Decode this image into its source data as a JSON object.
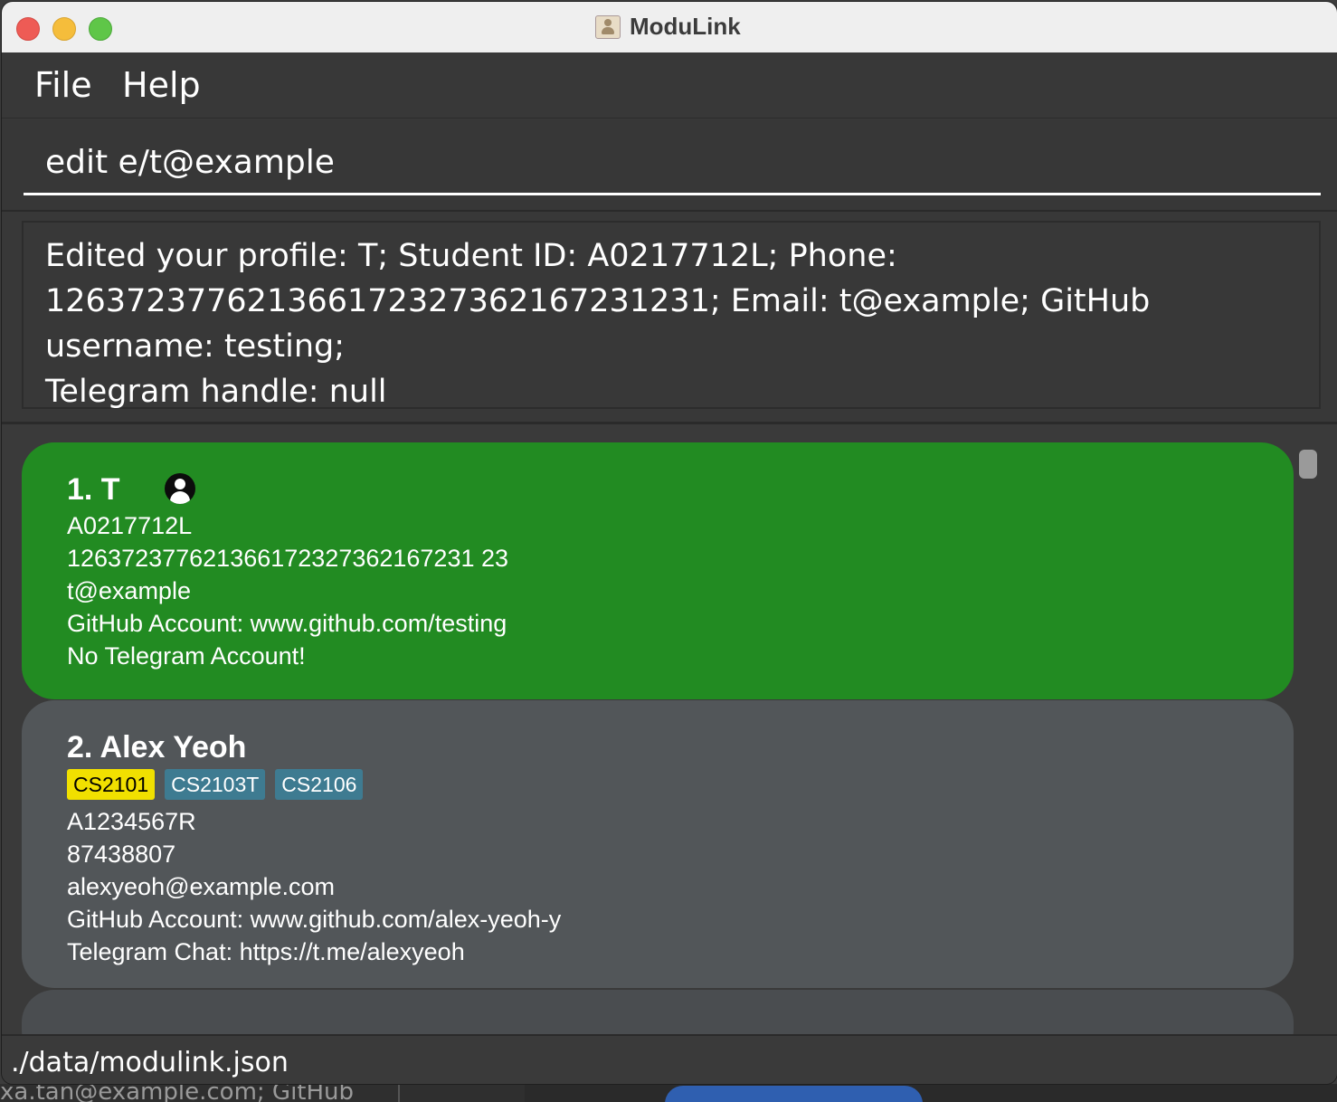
{
  "window": {
    "title": "ModuLink"
  },
  "menu": {
    "file": "File",
    "help": "Help"
  },
  "command": {
    "value": "edit e/t@example"
  },
  "result": {
    "line1": "Edited your profile: T; Student ID: A0217712L; Phone:",
    "line2": "126372377621366172327362167231231; Email: t@example; GitHub username: testing;",
    "line3": "Telegram handle: null"
  },
  "persons": [
    {
      "name": "1. T",
      "student_id": "A0217712L",
      "phone": "126372377621366172327362167231 23",
      "email": "t@example",
      "github": "GitHub Account: www.github.com/testing",
      "telegram": "No Telegram Account!",
      "tags": []
    },
    {
      "name": "2. Alex Yeoh",
      "tags": [
        "CS2101",
        "CS2103T",
        "CS2106"
      ],
      "student_id": "A1234567R",
      "phone": "87438807",
      "email": "alexyeoh@example.com",
      "github": "GitHub Account: www.github.com/alex-yeoh-y",
      "telegram": "Telegram Chat: https://t.me/alexyeoh"
    }
  ],
  "status": {
    "path": "./data/modulink.json"
  },
  "background": {
    "text": "xa.tan@example.com; GitHub"
  },
  "colors": {
    "selected_card": "#228b22",
    "card": "#525659",
    "tag_highlight": "#f1e000",
    "tag": "#3e7b91"
  }
}
